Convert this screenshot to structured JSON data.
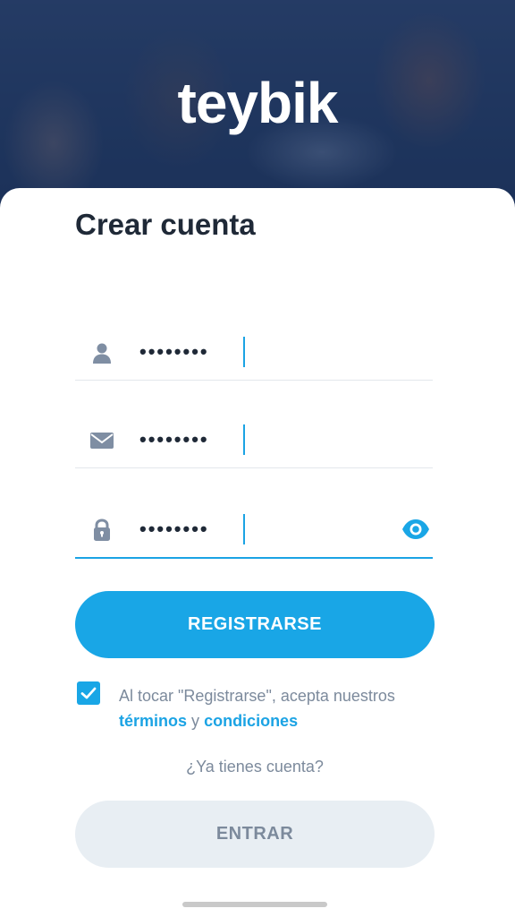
{
  "brand": {
    "logo_text": "teybik"
  },
  "form": {
    "title": "Crear cuenta",
    "name_field": {
      "value": "••••••••",
      "icon": "user-icon"
    },
    "email_field": {
      "value": "••••••••",
      "icon": "mail-icon"
    },
    "password_field": {
      "value": "••••••••",
      "icon": "lock-icon",
      "toggle_icon": "eye-icon"
    },
    "register_label": "REGISTRARSE",
    "terms": {
      "checked": true,
      "prefix": "Al tocar \"Registrarse\", acepta nuestros",
      "terms_link": "términos",
      "connector": "y",
      "conditions_link": "condiciones"
    },
    "have_account": "¿Ya tienes cuenta?",
    "login_label": "ENTRAR"
  },
  "colors": {
    "accent": "#19a6e6",
    "text_dark": "#1f2937",
    "text_muted": "#7c8a9c",
    "icon_gray": "#7f8ea3",
    "secondary_button": "#e8eef3"
  }
}
